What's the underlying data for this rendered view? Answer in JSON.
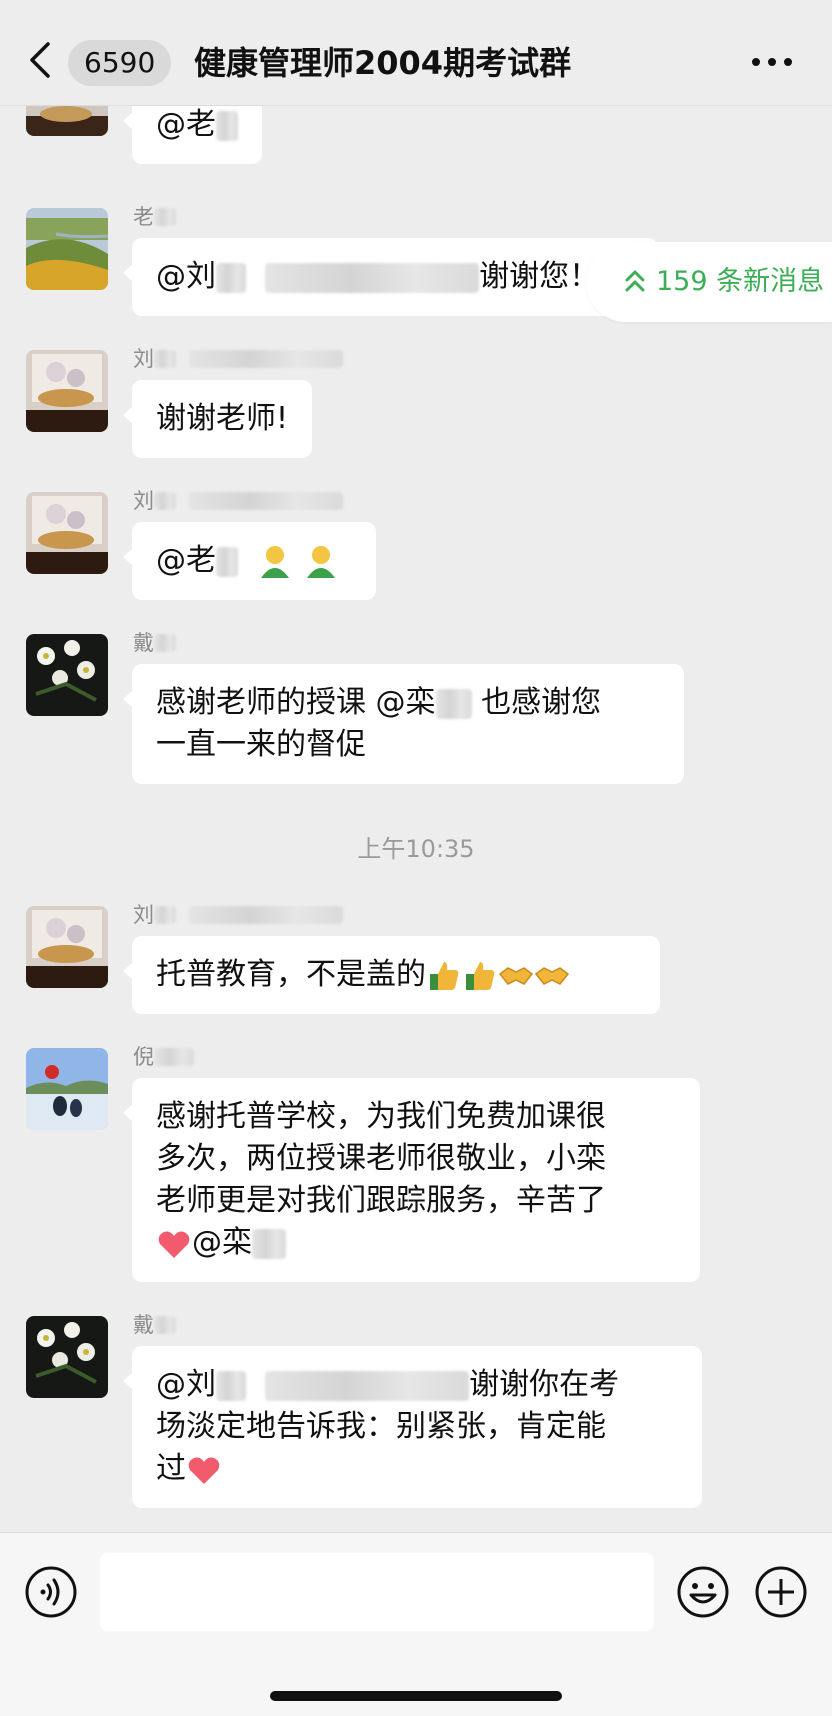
{
  "header": {
    "back_icon": "chevron-left-icon",
    "unread_count": "6590",
    "title": "健康管理师2004期考试群",
    "more_icon": "more-dots-icon"
  },
  "new_messages": {
    "text": "159 条新消息",
    "icon": "double-chevron-up-icon",
    "color": "#3cae56"
  },
  "messages": [
    {
      "sender": "",
      "text": "@老"
    },
    {
      "sender": "老",
      "text_a": "@刘",
      "text_b": "谢谢您！"
    },
    {
      "sender": "刘",
      "text": "谢谢老师!"
    },
    {
      "sender": "刘",
      "text": "@老",
      "emoji": "person-emoji"
    },
    {
      "sender": "戴",
      "line1_a": "感谢老师的授课 @栾",
      "line1_b": " 也感谢您",
      "line2": "一直一来的督促"
    },
    {
      "sender": "刘",
      "text": "托普教育，不是盖的",
      "emoji": "thumbs-up handshake"
    },
    {
      "sender": "倪",
      "line1": "感谢托普学校，为我们免费加课很",
      "line2": "多次，两位授课老师很敬业，小栾",
      "line3": "老师更是对我们跟踪服务，辛苦了",
      "line4": "@栾"
    },
    {
      "sender": "戴",
      "line1_a": "@刘",
      "line1_b": "谢谢你在考",
      "line2": "场淡定地告诉我：别紧张，肯定能",
      "line3": "过"
    }
  ],
  "time_divider": "上午10:35",
  "input_bar": {
    "voice_icon": "voice-icon",
    "emoji_icon": "emoji-icon",
    "plus_icon": "plus-icon"
  },
  "colors": {
    "background": "#ededed",
    "bubble": "#ffffff",
    "accent": "#3cae56"
  }
}
